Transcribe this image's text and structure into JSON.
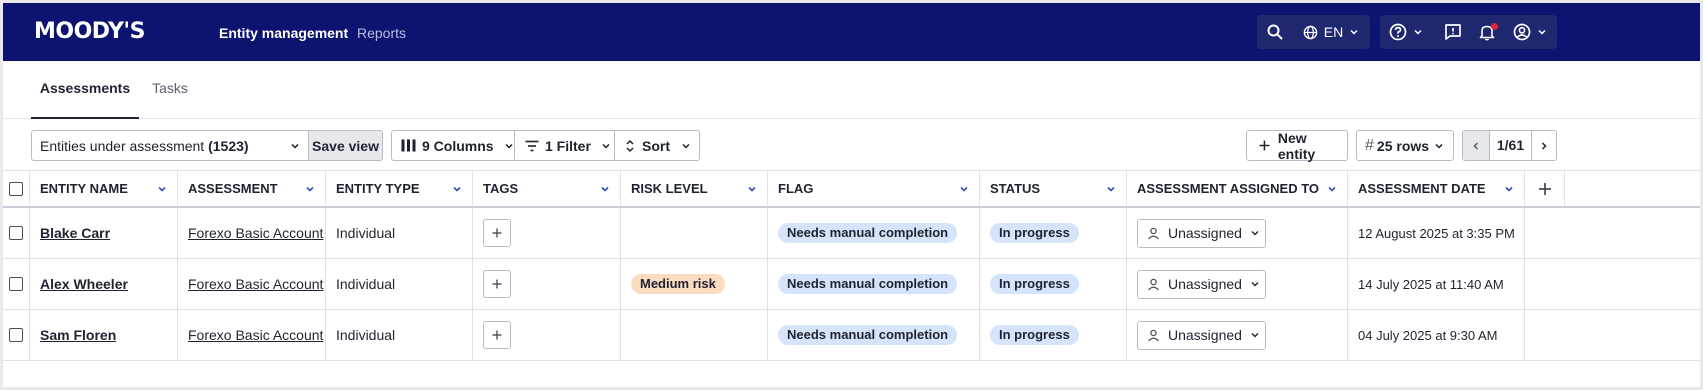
{
  "header": {
    "logo": "MOODY'S",
    "nav": [
      {
        "label": "Entity management",
        "active": true
      },
      {
        "label": "Reports",
        "active": false
      }
    ],
    "language": "EN"
  },
  "tabs": [
    {
      "label": "Assessments",
      "active": true
    },
    {
      "label": "Tasks",
      "active": false
    }
  ],
  "toolbar": {
    "view_label": "Entities under assessment",
    "view_count": "(1523)",
    "save_view": "Save view",
    "columns": "9 Columns",
    "filter": "1 Filter",
    "sort": "Sort",
    "new_entity": "New entity",
    "rows_symbol": "#",
    "rows": "25 rows",
    "page": "1/61"
  },
  "table": {
    "columns": [
      "ENTITY NAME",
      "ASSESSMENT",
      "ENTITY TYPE",
      "TAGS",
      "RISK LEVEL",
      "FLAG",
      "STATUS",
      "ASSESSMENT ASSIGNED TO",
      "ASSESSMENT DATE"
    ],
    "rows": [
      {
        "entity_name": "Blake Carr",
        "assessment": "Forexo Basic Account",
        "entity_type": "Individual",
        "risk_level": "",
        "flag": "Needs manual completion",
        "status": "In progress",
        "assigned_to": "Unassigned",
        "date": "12 August 2025 at 3:35 PM"
      },
      {
        "entity_name": "Alex Wheeler",
        "assessment": "Forexo Basic Account",
        "entity_type": "Individual",
        "risk_level": "Medium risk",
        "flag": "Needs manual completion",
        "status": "In progress",
        "assigned_to": "Unassigned",
        "date": "14 July 2025 at 11:40 AM"
      },
      {
        "entity_name": "Sam Floren",
        "assessment": "Forexo Basic Account",
        "entity_type": "Individual",
        "risk_level": "",
        "flag": "Needs manual completion",
        "status": "In progress",
        "assigned_to": "Unassigned",
        "date": "04 July 2025 at 9:30 AM"
      }
    ]
  },
  "colors": {
    "header_bg": "#0d1470",
    "pill_blue": "#d5e4fb",
    "pill_orange": "#fbdcc0",
    "notification_dot": "#e0243b"
  }
}
